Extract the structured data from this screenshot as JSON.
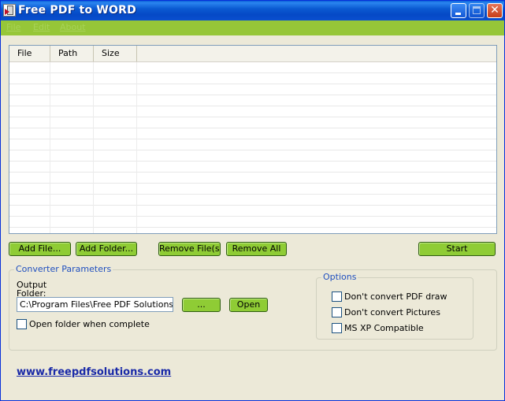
{
  "window": {
    "title": "Free PDF to WORD",
    "accent": "#96c638",
    "title_bar_color": "#0549c6"
  },
  "menu": {
    "items": [
      "File",
      "Edit",
      "About"
    ]
  },
  "file_list": {
    "columns": [
      "File",
      "Path",
      "Size"
    ],
    "rows": []
  },
  "buttons": {
    "add_file": "Add File...",
    "add_folder": "Add Folder...",
    "remove_files": "Remove File(s)",
    "remove_all": "Remove All",
    "start": "Start",
    "browse": "...",
    "open": "Open"
  },
  "converter": {
    "legend": "Converter Parameters",
    "output_label": "Output Folder:",
    "output_value": "C:\\Program Files\\Free PDF Solutions",
    "open_when_complete": "Open folder when complete",
    "open_when_complete_checked": false
  },
  "options": {
    "legend": "Options",
    "items": [
      {
        "label": "Don't convert PDF draw",
        "checked": false
      },
      {
        "label": "Don't convert Pictures",
        "checked": false
      },
      {
        "label": "MS XP Compatible",
        "checked": false
      }
    ]
  },
  "footer": {
    "link_text": "www.freepdfsolutions.com"
  }
}
